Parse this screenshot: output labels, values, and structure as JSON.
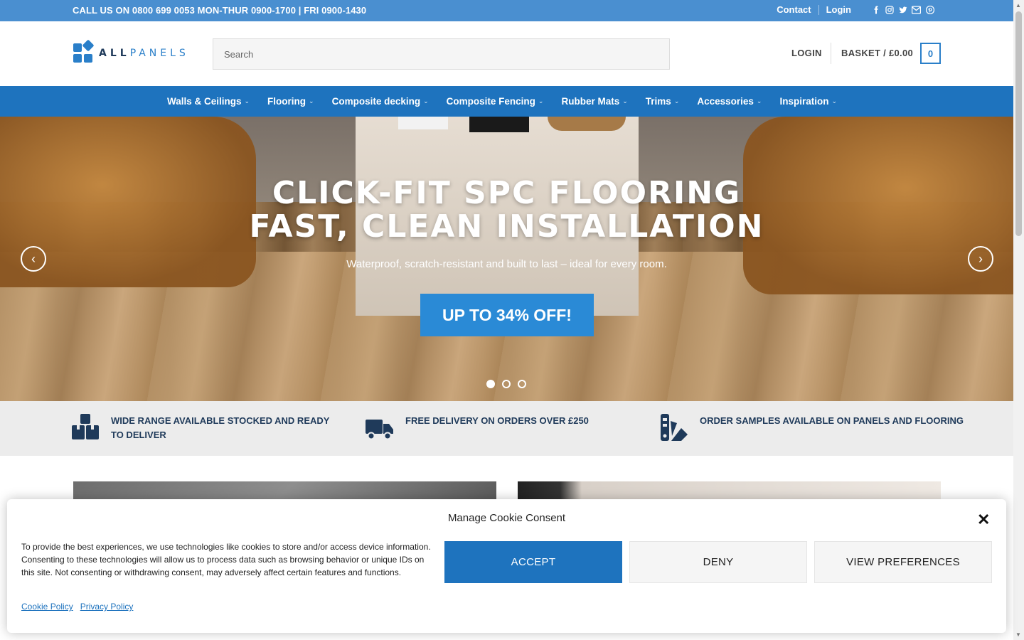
{
  "topbar": {
    "phone": "CALL US ON 0800 699 0053  MON-THUR 0900-1700 | FRI 0900-1430",
    "contact": "Contact",
    "login": "Login",
    "social": [
      "facebook-icon",
      "instagram-icon",
      "twitter-icon",
      "email-icon",
      "pinterest-icon"
    ]
  },
  "header": {
    "logo_text_bold": "ALL",
    "logo_text": "PANELS",
    "search_placeholder": "Search",
    "login": "LOGIN",
    "basket": "BASKET / £0.00",
    "cart_count": "0"
  },
  "nav": {
    "items": [
      {
        "label": "Walls & Ceilings"
      },
      {
        "label": "Flooring"
      },
      {
        "label": "Composite decking"
      },
      {
        "label": "Composite Fencing"
      },
      {
        "label": "Rubber Mats"
      },
      {
        "label": "Trims"
      },
      {
        "label": "Accessories"
      },
      {
        "label": "Inspiration"
      }
    ]
  },
  "hero": {
    "title_line1": "CLICK-FIT SPC FLOORING",
    "title_line2": "FAST, CLEAN INSTALLATION",
    "subtitle": "Waterproof, scratch-resistant and built to last – ideal for every room.",
    "cta": "UP TO 34% OFF!",
    "slides": 3,
    "active_slide": 1
  },
  "features": [
    {
      "icon": "boxes-icon",
      "text": "WIDE RANGE AVAILABLE STOCKED AND READY TO DELIVER"
    },
    {
      "icon": "truck-icon",
      "text": "FREE DELIVERY ON ORDERS OVER £250"
    },
    {
      "icon": "swatch-icon",
      "text": "ORDER SAMPLES AVAILABLE ON PANELS AND FLOORING"
    }
  ],
  "cookie": {
    "title": "Manage Cookie Consent",
    "message": "To provide the best experiences, we use technologies like cookies to store and/or access device information. Consenting to these technologies will allow us to process data such as browsing behavior or unique IDs on this site. Not consenting or withdrawing consent, may adversely affect certain features and functions.",
    "accept": "ACCEPT",
    "deny": "DENY",
    "preferences": "VIEW PREFERENCES",
    "cookie_policy": "Cookie Policy",
    "privacy_policy": "Privacy Policy"
  },
  "colors": {
    "topbar": "#4a8fd0",
    "nav": "#1e73be",
    "brand": "#2a7fc9",
    "cta": "#2a8ad6",
    "dark": "#1f3a5a"
  }
}
